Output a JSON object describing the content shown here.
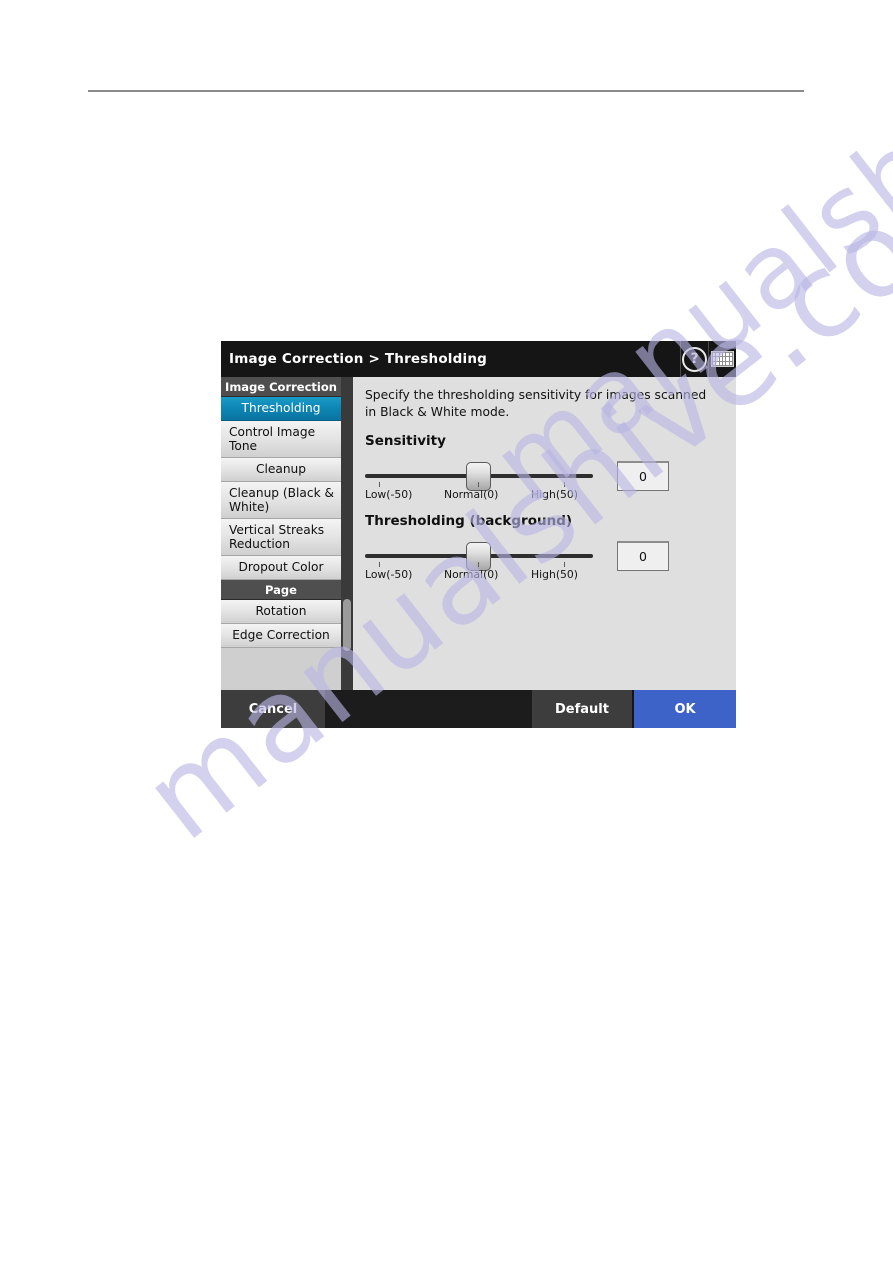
{
  "dialog": {
    "titlebar": {
      "breadcrumb_parent": "Image Correction",
      "breadcrumb_separator": ">",
      "breadcrumb_current": "Thresholding",
      "title_full": "Image Correction > Thresholding",
      "help_icon": "help-question-icon",
      "help_glyph": "?",
      "keyboard_icon": "keyboard-icon"
    },
    "sidebar": {
      "sections": [
        {
          "header": "Image Correction",
          "items": [
            {
              "label": "Thresholding",
              "selected": true
            },
            {
              "label": "Control Image Tone",
              "selected": false
            },
            {
              "label": "Cleanup",
              "selected": false
            },
            {
              "label": "Cleanup (Black & White)",
              "selected": false
            },
            {
              "label": "Vertical Streaks Reduction",
              "selected": false
            },
            {
              "label": "Dropout Color",
              "selected": false
            }
          ]
        },
        {
          "header": "Page",
          "items": [
            {
              "label": "Rotation",
              "selected": false
            },
            {
              "label": "Edge Correction",
              "selected": false
            }
          ]
        }
      ],
      "scrollbar": "sidebar-scrollbar"
    },
    "panel": {
      "description": "Specify the thresholding sensitivity for images scanned in Black & White mode.",
      "groups": [
        {
          "title": "Sensitivity",
          "slider": {
            "value": "0",
            "min_label": "Low(-50)",
            "mid_label": "Normal(0)",
            "max_label": "High(50)",
            "min": -50,
            "max": 50,
            "current": 0
          }
        },
        {
          "title": "Thresholding (background)",
          "slider": {
            "value": "0",
            "min_label": "Low(-50)",
            "mid_label": "Normal(0)",
            "max_label": "High(50)",
            "min": -50,
            "max": 50,
            "current": 0
          }
        }
      ]
    },
    "footer": {
      "cancel_label": "Cancel",
      "default_label": "Default",
      "ok_label": "OK",
      "ok_color": "#3d63c8"
    }
  },
  "watermark": {
    "line1": "manualshive.com",
    "line2": "manualshive.com"
  }
}
